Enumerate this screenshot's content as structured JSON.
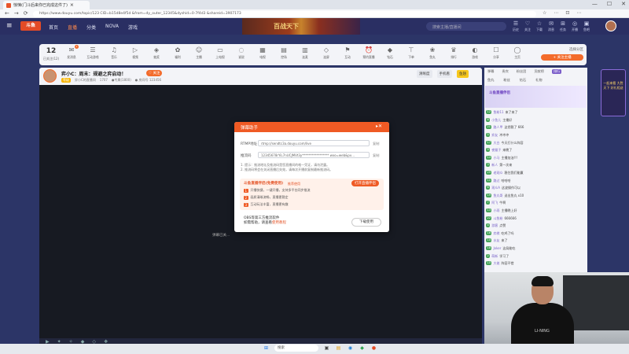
{
  "browser": {
    "tab_title": "惊悚(门斗后来你已完成这件了)",
    "url": "https://www.douyu.com/topic/123 CID=b15d8e4f5d  &from=dy_outer_12345&dyshid=0-7f4d3  &shareid=3907173",
    "nav": [
      "←",
      "→",
      "⟳"
    ],
    "window_controls": [
      "—",
      "☐",
      "✕"
    ],
    "toolbar_icons": [
      "☆",
      "⋯",
      "⊡",
      "⋯"
    ]
  },
  "header": {
    "logo": "斗鱼",
    "nav": [
      "首页",
      "直播",
      "分类",
      "NOVA",
      "游戏"
    ],
    "banner_text": "百战天下",
    "search_placeholder": "搜索主播/直播间",
    "icons": [
      {
        "glyph": "☰",
        "label": "历史"
      },
      {
        "glyph": "♡",
        "label": "关注"
      },
      {
        "glyph": "☆",
        "label": "下载"
      },
      {
        "glyph": "✉",
        "label": "消息"
      },
      {
        "glyph": "⊞",
        "label": "任务"
      },
      {
        "glyph": "◎",
        "label": "开播"
      },
      {
        "glyph": "▣",
        "label": "鱼吧"
      }
    ]
  },
  "category_strip": {
    "count": "12",
    "count_label": "已关注(12)",
    "items": [
      {
        "label": "发消息",
        "icon": "✉",
        "badge": "1"
      },
      {
        "label": "互动游戏",
        "icon": "☰",
        "badge": ""
      },
      {
        "label": "音乐",
        "icon": "♫",
        "badge": ""
      },
      {
        "label": "视频",
        "icon": "▷",
        "badge": ""
      },
      {
        "label": "抽奖",
        "icon": "◈",
        "badge": ""
      },
      {
        "label": "福利",
        "icon": "✿",
        "badge": ""
      },
      {
        "label": "主播",
        "icon": "☺",
        "badge": ""
      },
      {
        "label": "上电视",
        "icon": "▭",
        "badge": ""
      },
      {
        "label": "说说",
        "icon": "◌",
        "badge": ""
      },
      {
        "label": "电视",
        "icon": "▦",
        "badge": ""
      },
      {
        "label": "控场",
        "icon": "▤",
        "badge": ""
      },
      {
        "label": "连麦",
        "icon": "▥",
        "badge": ""
      },
      {
        "label": "连屏",
        "icon": "◇",
        "badge": ""
      },
      {
        "label": "互动",
        "icon": "⚑",
        "badge": ""
      },
      {
        "label": "预约直播",
        "icon": "⏰",
        "badge": ""
      },
      {
        "label": "钻石",
        "icon": "◆",
        "badge": ""
      },
      {
        "label": "下单",
        "icon": "⊤",
        "badge": ""
      },
      {
        "label": "鱼丸",
        "icon": "❀",
        "badge": ""
      },
      {
        "label": "排行",
        "icon": "♛",
        "badge": ""
      },
      {
        "label": "游戏",
        "icon": "◐",
        "badge": ""
      },
      {
        "label": "分享",
        "icon": "☐",
        "badge": ""
      },
      {
        "label": "主页",
        "icon": "◯",
        "badge": ""
      }
    ],
    "right_title": "选择分区",
    "right_button": "+ 关注主播"
  },
  "room": {
    "title": "弈小C：周末：规避之弈启动！",
    "favorite": "♡ 关注",
    "level_tag": "等级",
    "meta": [
      "弈小C的直播间",
      "1707",
      "●专属(1800)",
      "● 房间号 123456"
    ],
    "controls": [
      "清晰度",
      "手机看",
      "鱼翅"
    ]
  },
  "video": {
    "caption": "弹幕已关..."
  },
  "modal": {
    "title": "弹幕助手",
    "server_label": "RTMP地址",
    "server_value": "rtmp://sendtc3a.douyu.com/live",
    "server_link": "复制",
    "key_label": "推流码",
    "key_value": "12345678rYiL7nUCJMVt3y*****************  wxo=web&pv…",
    "key_link": "复制",
    "tips": [
      "1. 提示：推流地址及推流码是您直播间的唯一凭证，请勿泄露。",
      "2. 推流码将会在关闭直播后失效，请每次开播前复制最新推流码。"
    ],
    "promo_title": "斗鱼直播伴侣(免费使用)",
    "promo_badge": "推荐使用",
    "promo_button": "打开直播伴侣",
    "promo_lines": [
      {
        "n": "1",
        "text": "开播快捷，一键开播，支持多平台同步推流"
      },
      {
        "n": "2",
        "text": "画质清晰流畅，直播更稳定"
      },
      {
        "n": "3",
        "text": "互动玩法丰富，直播更有趣"
      }
    ],
    "helper_title": "OBS等第三方推流软件",
    "helper_text": "如需帮助，请查看",
    "helper_link": "使用教程",
    "download_button": "下载使用"
  },
  "side": {
    "tabs": [
      "弹幕",
      "贵宾",
      "粉丝团",
      "贡献榜",
      "排行"
    ],
    "subtabs": [
      "鱼丸",
      "粉丝",
      "钻石",
      "礼物"
    ],
    "promo_text": "斗鱼直播伴侣",
    "messages": [
      {
        "lv": "12",
        "name": "鱼粉11",
        "text": "来了来了"
      },
      {
        "lv": "8",
        "name": "小鱼儿",
        "text": "主播好"
      },
      {
        "lv": "21",
        "name": "路人甲",
        "text": "这把稳了 666"
      },
      {
        "lv": "5",
        "name": "弈友",
        "text": "冲冲冲"
      },
      {
        "lv": "17",
        "name": "大白",
        "text": "今天打什么阵容"
      },
      {
        "lv": "9",
        "name": "夜猫子",
        "text": "来晚了"
      },
      {
        "lv": "14",
        "name": "小马",
        "text": "主播加油!!!"
      },
      {
        "lv": "3",
        "name": "新人",
        "text": "第一次来"
      },
      {
        "lv": "25",
        "name": "老观众",
        "text": "稳住我们能赢"
      },
      {
        "lv": "11",
        "name": "路过",
        "text": "哈哈哈"
      },
      {
        "lv": "6",
        "name": "观众A",
        "text": "这波操作可以"
      },
      {
        "lv": "19",
        "name": "鱼丸哥",
        "text": "送出鱼丸 x10"
      },
      {
        "lv": "7",
        "name": "阿飞",
        "text": "牛啊"
      },
      {
        "lv": "13",
        "name": "小雨",
        "text": "主播晚上好"
      },
      {
        "lv": "22",
        "name": "斗鱼粉",
        "text": "666666"
      },
      {
        "lv": "4",
        "name": "游客",
        "text": "点赞"
      },
      {
        "lv": "16",
        "name": "弈棋",
        "text": "吃鸡了吗"
      },
      {
        "lv": "10",
        "name": "水友",
        "text": "来了"
      },
      {
        "lv": "18",
        "name": "Joker",
        "text": "这局能吃"
      },
      {
        "lv": "2",
        "name": "萌新",
        "text": "学习了"
      },
      {
        "lv": "15",
        "name": "大佬",
        "text": "阵容不错"
      }
    ]
  },
  "right_ad": {
    "text": "一起来看 大胜天下 好礼相送"
  },
  "webcam": {
    "shirt_logo": "LI-NING"
  },
  "taskbar": {
    "search_placeholder": "搜索",
    "icons": [
      "⊞",
      "▣",
      "▤",
      "◉",
      "◆",
      "●"
    ]
  },
  "colors": {
    "accent": "#ef5a24",
    "header_bg": "#2a2f63",
    "page_bg": "#2c3567"
  }
}
